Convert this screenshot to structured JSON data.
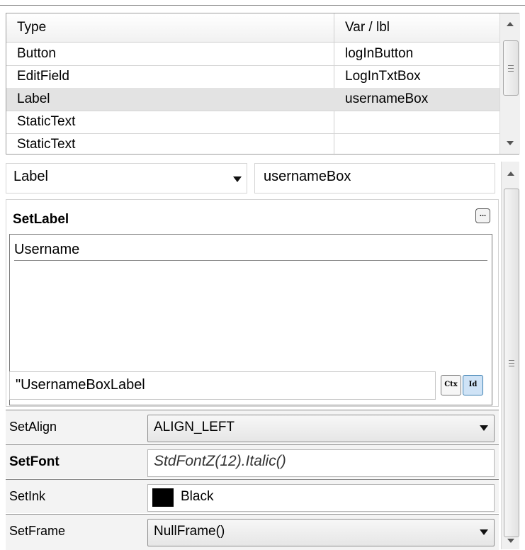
{
  "grid": {
    "columns": [
      "Type",
      "Var / lbl"
    ],
    "rows": [
      {
        "type": "Button",
        "var": "logInButton",
        "selected": false
      },
      {
        "type": "EditField",
        "var": "LogInTxtBox",
        "selected": false
      },
      {
        "type": "Label",
        "var": "usernameBox",
        "selected": true
      },
      {
        "type": "StaticText",
        "var": "",
        "selected": false
      },
      {
        "type": "StaticText",
        "var": "",
        "selected": false
      }
    ]
  },
  "editor": {
    "type_select": "Label",
    "var_name": "usernameBox",
    "set_label": {
      "title": "SetLabel",
      "ellipsis": "...",
      "text": "Username",
      "id_value": "\"UsernameBoxLabel",
      "ctx_label": "Ctx",
      "id_label": "Id"
    },
    "properties": [
      {
        "name": "SetAlign",
        "value": "ALIGN_LEFT",
        "kind": "combo",
        "bold": false
      },
      {
        "name": "SetFont",
        "value": "StdFontZ(12).Italic()",
        "kind": "text-italic",
        "bold": true
      },
      {
        "name": "SetInk",
        "value": "Black",
        "kind": "color",
        "color": "#000000",
        "bold": false
      },
      {
        "name": "SetFrame",
        "value": "NullFrame()",
        "kind": "combo",
        "bold": false
      }
    ]
  }
}
